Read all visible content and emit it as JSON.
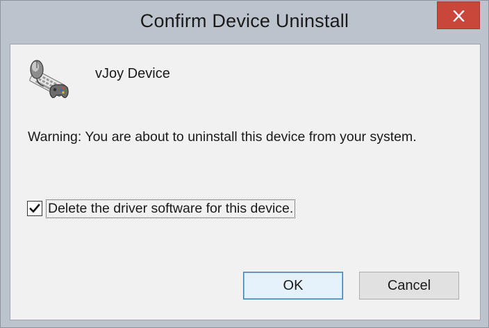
{
  "window": {
    "title": "Confirm Device Uninstall",
    "close_icon": "close-icon"
  },
  "device": {
    "icon": "vjoy-device-icon",
    "name": "vJoy Device"
  },
  "message": {
    "warning": "Warning: You are about to uninstall this device from your system."
  },
  "options": {
    "delete_driver": {
      "label": "Delete the driver software for this device.",
      "checked": true
    }
  },
  "buttons": {
    "ok_label": "OK",
    "cancel_label": "Cancel"
  },
  "colors": {
    "frame": "#bcc3cd",
    "close_button": "#c9463b",
    "client_background": "#f1f1f1",
    "default_button_border": "#3c7fb1"
  }
}
